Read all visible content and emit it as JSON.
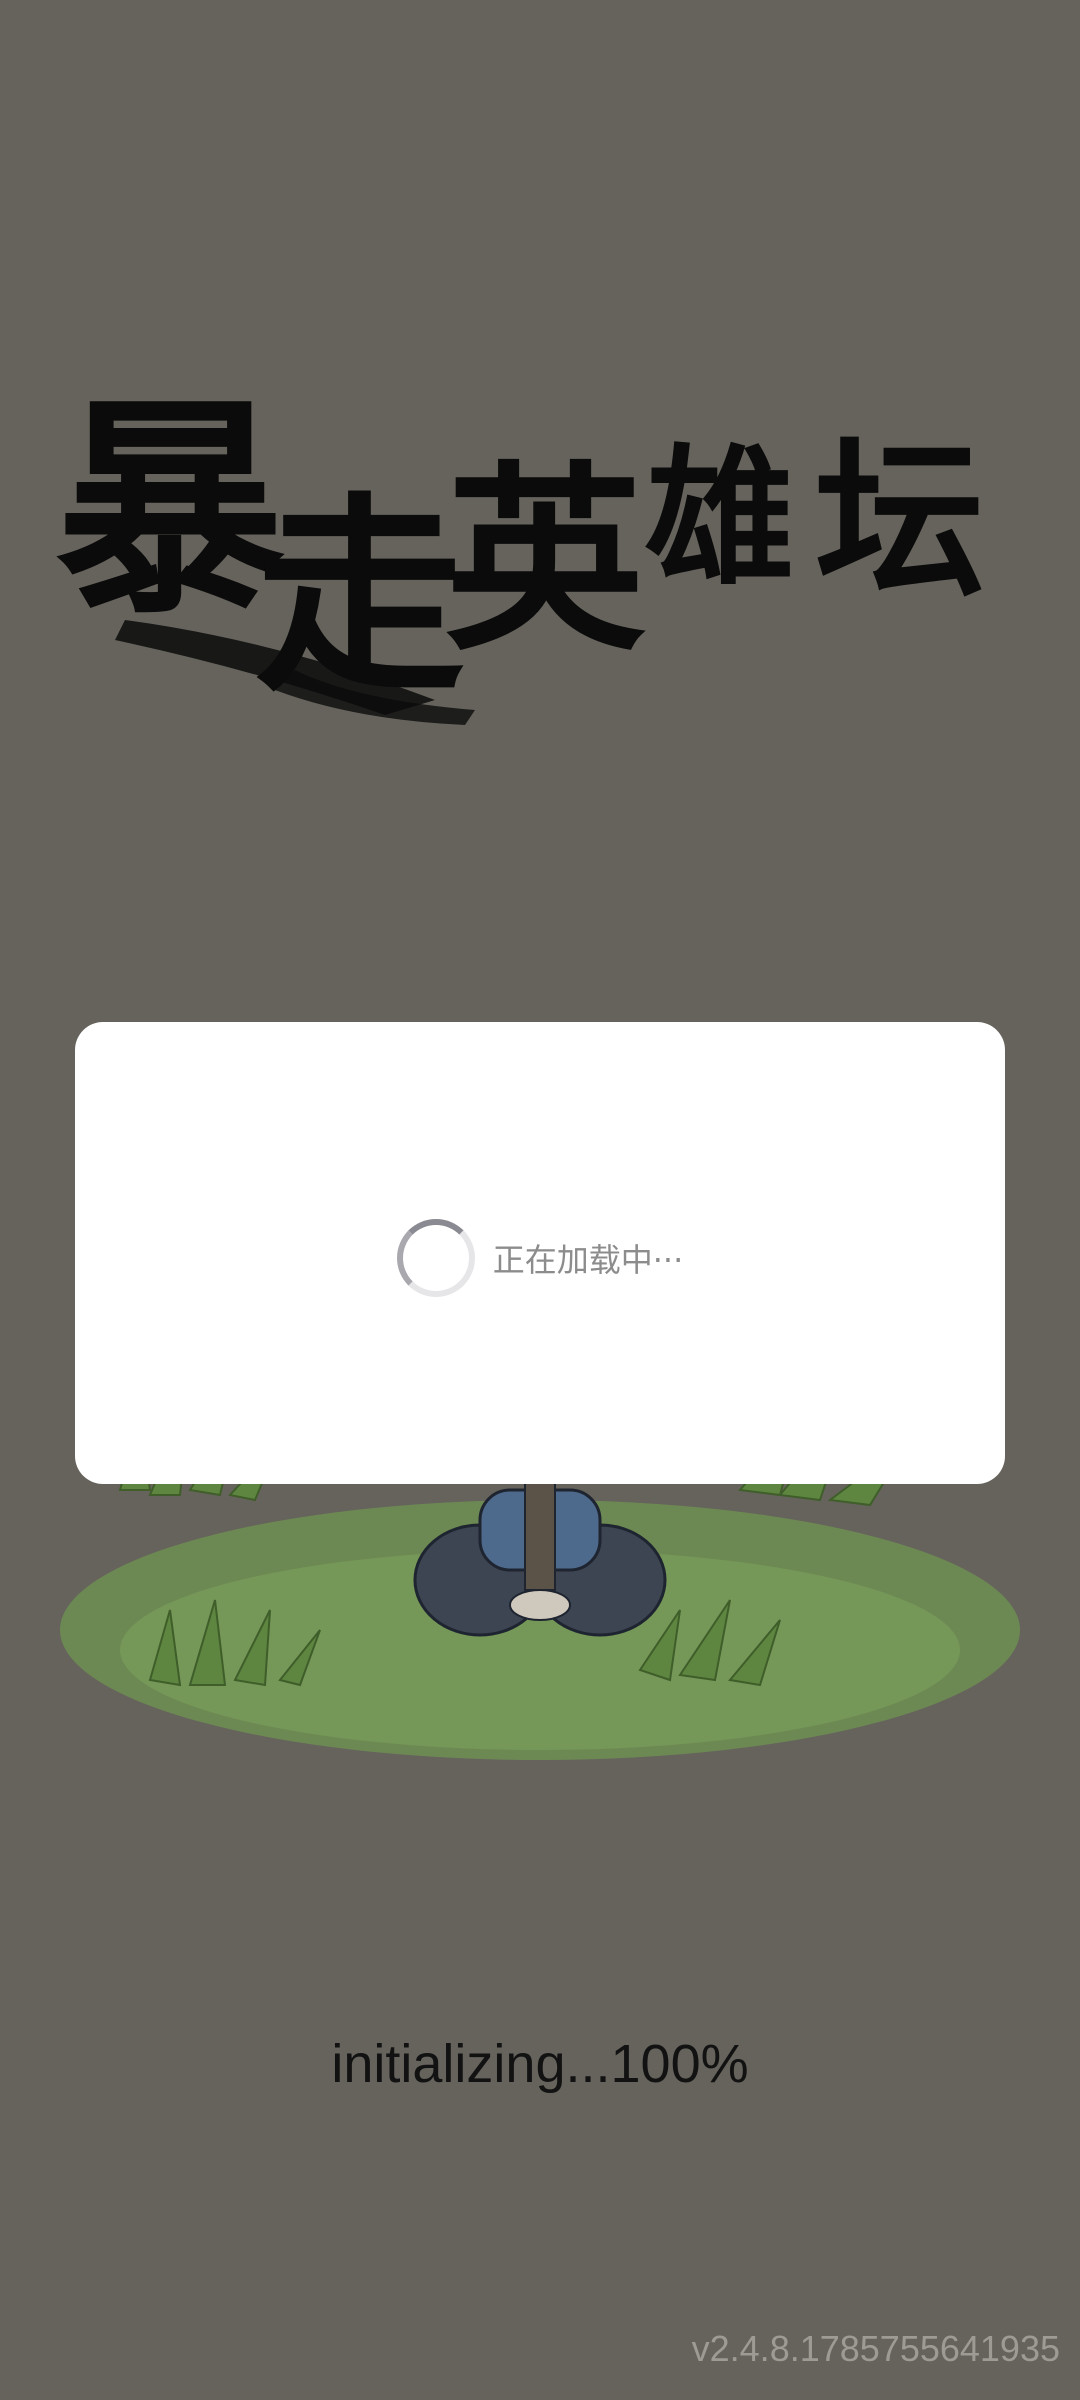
{
  "game": {
    "title_logo": "暴走英雄坛",
    "title_chars": [
      "暴",
      "走",
      "英",
      "雄",
      "坛"
    ]
  },
  "colors": {
    "background": "#66635c",
    "modal": "#ffffff",
    "grass": "#6f9550",
    "logo_ink": "#0b0b0b",
    "status_text": "#121212",
    "version_text": "#9e9b95"
  },
  "loading_dialog": {
    "text": "正在加载中···",
    "spinner_icon": "loading-spinner-icon"
  },
  "status": {
    "text": "initializing...100%",
    "progress_percent": 100
  },
  "version": {
    "text": "v2.4.8.1785755641935"
  }
}
